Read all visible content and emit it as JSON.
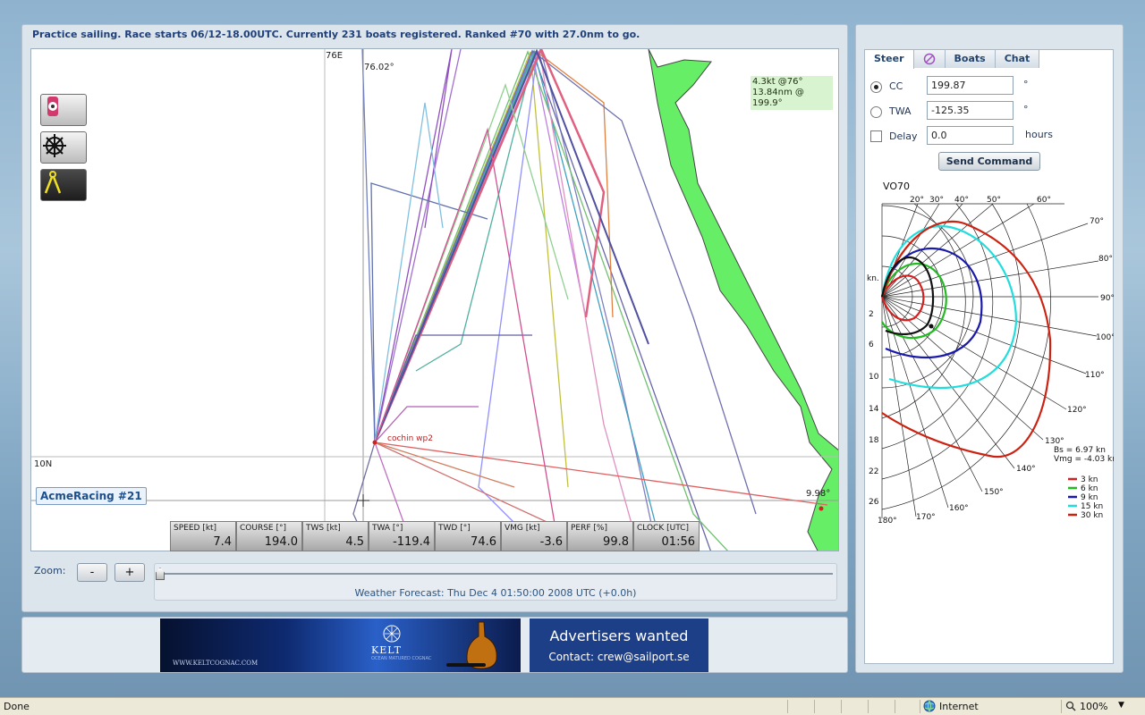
{
  "status_line": "Practice sailing. Race starts 06/12-18.00UTC. Currently 231 boats registered. Ranked #70 with 27.0nm to go.",
  "map": {
    "lon_label": "76E",
    "lon_value": "76.02°",
    "lat_label": "10N",
    "lat_value": "9.98°",
    "waypoint_label": "cochin wp2",
    "tooltip_line1": "4.3kt @76°",
    "tooltip_line2": "13.84nm @ 199.9°",
    "boat_name": "AcmeRacing #21",
    "land_color": "#66ee66",
    "tools": [
      {
        "name": "compass-icon"
      },
      {
        "name": "helm-icon"
      },
      {
        "name": "measure-icon"
      }
    ]
  },
  "instruments": [
    {
      "label": "SPEED [kt]",
      "value": "7.4"
    },
    {
      "label": "COURSE [°]",
      "value": "194.0"
    },
    {
      "label": "TWS [kt]",
      "value": "4.5"
    },
    {
      "label": "TWA [°]",
      "value": "-119.4"
    },
    {
      "label": "TWD [°]",
      "value": "74.6"
    },
    {
      "label": "VMG [kt]",
      "value": "-3.6"
    },
    {
      "label": "PERF [%]",
      "value": "99.8"
    },
    {
      "label": "CLOCK [UTC]",
      "value": "01:56"
    }
  ],
  "zoom": {
    "label": "Zoom:",
    "minus": "-",
    "plus": "+"
  },
  "forecast_text": "Weather Forecast: Thu Dec 4 01:50:00 2008 UTC (+0.0h)",
  "ads": {
    "kelt_brand": "KELT",
    "kelt_tagline": "OCEAN MATURED COGNAC",
    "kelt_url": "WWW.KELTCOGNAC.COM",
    "wanted_title": "Advertisers wanted",
    "wanted_contact": "Contact: crew@sailport.se"
  },
  "side": {
    "tabs": [
      {
        "label": "Steer",
        "active": true
      },
      {
        "label": "",
        "icon": "compass-tab-icon"
      },
      {
        "label": "Boats"
      },
      {
        "label": "Chat"
      }
    ],
    "cc_label": "CC",
    "cc_value": "199.87",
    "twa_label": "TWA",
    "twa_value": "-125.35",
    "delay_label": "Delay",
    "delay_value": "0.0",
    "deg_unit": "°",
    "hours_unit": "hours",
    "send_label": "Send Command"
  },
  "polar": {
    "title": "VO70",
    "angle_labels_top": [
      "20°",
      "30°",
      "40°",
      "50°",
      "60°"
    ],
    "angle_labels_right": [
      "70°",
      "80°",
      "90°",
      "100°",
      "110°",
      "120°",
      "130°",
      "140°",
      "150°",
      "160°",
      "170°",
      "180°"
    ],
    "speed_axis_label": "kn.",
    "speed_labels": [
      "2",
      "6",
      "10",
      "14",
      "18",
      "22",
      "26"
    ],
    "bs_text": "Bs   = 6.97 kn",
    "vmg_text": "Vmg = -4.03 kn",
    "legend": [
      {
        "label": "3 kn",
        "color": "#d42020"
      },
      {
        "label": "6 kn",
        "color": "#22bb22"
      },
      {
        "label": "9 kn",
        "color": "#1a1aaa"
      },
      {
        "label": "15 kn",
        "color": "#22dddd"
      },
      {
        "label": "30 kn",
        "color": "#cc2211"
      }
    ]
  },
  "statusbar": {
    "done": "Done",
    "zone": "Internet",
    "zoom": "100%"
  }
}
